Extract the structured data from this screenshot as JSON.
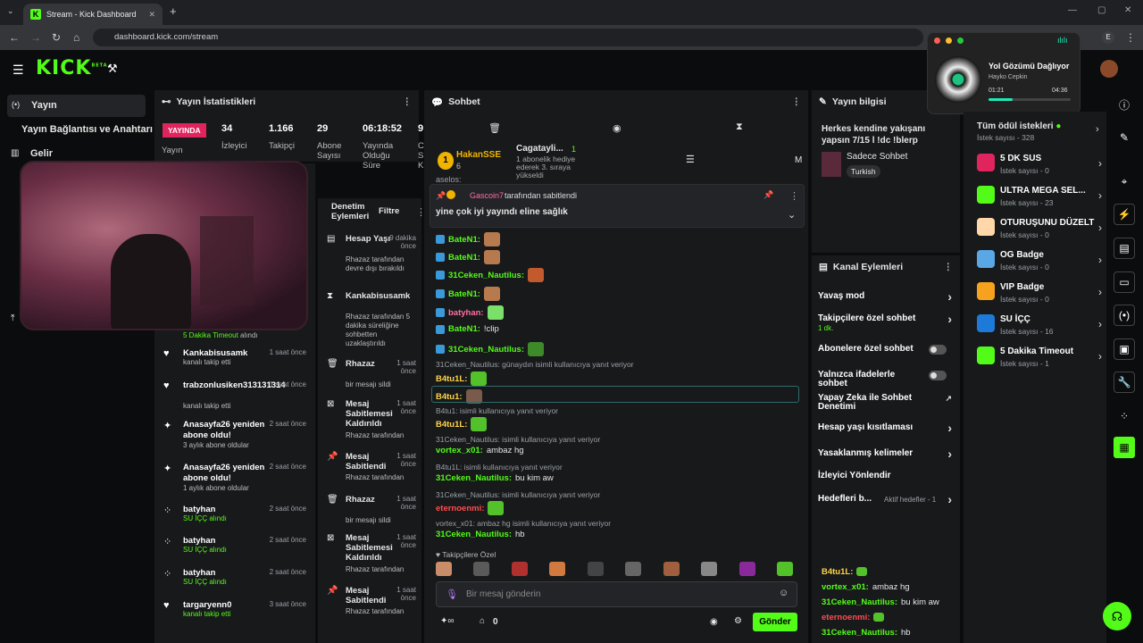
{
  "browser": {
    "tab_title": "Stream - Kick Dashboard",
    "url": "dashboard.kick.com/stream",
    "profile": "E"
  },
  "logo": {
    "text": "KICK",
    "beta": "BETA"
  },
  "nav": {
    "items": [
      {
        "label": "Yayın",
        "icon": "broadcast-icon"
      },
      {
        "label": "Yayın Bağlantısı ve Anahtarı"
      },
      {
        "label": "Gelir",
        "icon": "chart-icon"
      }
    ]
  },
  "stats": {
    "title": "Yayın İstatistikleri",
    "live": "YAYINDA",
    "live_label": "Yayın",
    "items": [
      {
        "value": "34",
        "label": "İzleyici"
      },
      {
        "value": "1.166",
        "label": "Takipçi"
      },
      {
        "value": "29",
        "label": "Abone Sayısı"
      },
      {
        "value": "06:18:52",
        "label": "Yayında Olduğu Süre"
      },
      {
        "value": "9",
        "label": "C S K"
      }
    ]
  },
  "mod": {
    "title": "Denetim Eylemleri",
    "filter": "Filtre",
    "items": [
      {
        "icon": "mute-icon",
        "name": "Hesap Yaşı",
        "time": "9 dakika önce",
        "desc": "Rhazaz tarafından devre dışı bırakıldı",
        "emph": "Rhazaz"
      },
      {
        "icon": "hourglass-icon",
        "name": "Kankabisusamk",
        "time": "",
        "desc": "Rhazaz tarafından 5 dakika süreliğine sohbetten uzaklaştırıldı",
        "emph": "Rhazaz"
      },
      {
        "icon": "trash-icon",
        "name": "Rhazaz",
        "time": "1 saat önce",
        "desc": "bir mesajı sildi",
        "emph": ""
      },
      {
        "icon": "unpin-icon",
        "name": "Mesaj Sabitlemesi Kaldırıldı",
        "time": "1 saat önce",
        "desc": "Rhazaz tarafından",
        "emph": "Rhazaz"
      },
      {
        "icon": "pin-icon",
        "name": "Mesaj Sabitlendi",
        "time": "1 saat önce",
        "desc": "Rhazaz tarafından",
        "emph": "Rhazaz"
      },
      {
        "icon": "trash-icon",
        "name": "Rhazaz",
        "time": "1 saat önce",
        "desc": "bir mesajı sildi",
        "emph": ""
      },
      {
        "icon": "unpin-icon",
        "name": "Mesaj Sabitlemesi Kaldırıldı",
        "time": "1 saat önce",
        "desc": "Rhazaz tarafından",
        "emph": "Rhazaz"
      },
      {
        "icon": "pin-icon",
        "name": "Mesaj Sabitlendi",
        "time": "1 saat önce",
        "desc": "Rhazaz tarafından",
        "emph": "Rhazaz"
      }
    ]
  },
  "activity": {
    "timeout_note": "5 Dakika Timeout",
    "timeout_suffix": "alındı",
    "items": [
      {
        "icon": "heart-icon",
        "name": "Kankabisusamk",
        "time": "1 saat önce",
        "desc": "kanalı takip etti"
      },
      {
        "icon": "heart-icon",
        "name": "trabzonlusiken313131314",
        "time": "1 saat önce",
        "desc": "kanalı takip etti"
      },
      {
        "icon": "sparkle-icon",
        "name": "Anasayfa26 yeniden abone oldu!",
        "time": "2 saat önce",
        "desc": "3 aylık abone oldular"
      },
      {
        "icon": "sparkle-icon",
        "name": "Anasayfa26 yeniden abone oldu!",
        "time": "2 saat önce",
        "desc": "1 aylık abone oldular"
      },
      {
        "icon": "reward-icon",
        "name": "batyhan",
        "time": "2 saat önce",
        "desc": "SU İÇÇ alındı"
      },
      {
        "icon": "reward-icon",
        "name": "batyhan",
        "time": "2 saat önce",
        "desc": "SU İÇÇ alındı"
      },
      {
        "icon": "reward-icon",
        "name": "batyhan",
        "time": "2 saat önce",
        "desc": "SU İÇÇ alındı"
      },
      {
        "icon": "heart-icon",
        "name": "targaryenn0",
        "time": "3 saat önce",
        "desc": "kanalı takip etti"
      }
    ]
  },
  "chat": {
    "title": "Sohbet",
    "top_user": "HakanSSE",
    "top_count": "6",
    "gift_user": "Cagatayli...",
    "gift_text": "1 abonelik hediye ederek 3. sıraya yükseldi",
    "gift_num": "1",
    "cut_user": "aselos:",
    "pinned_by": "Gascoin7",
    "pinned_suffix": "tarafından sabitlendi",
    "pinned_msg": "yine çok iyi yayındı eline sağlık",
    "messages": [
      {
        "user": "BateN1:",
        "color": "#53fc18",
        "text": ""
      },
      {
        "user": "BateN1:",
        "color": "#53fc18",
        "text": ""
      },
      {
        "user": "31Ceken_Nautilus:",
        "color": "#53fc18",
        "text": ""
      },
      {
        "user": "BateN1:",
        "color": "#53fc18",
        "text": ""
      },
      {
        "user": "batyhan:",
        "color": "#ff6fa1",
        "text": ""
      },
      {
        "user": "BateN1:",
        "color": "#53fc18",
        "text": "!clip"
      },
      {
        "user": "31Ceken_Nautilus:",
        "color": "#53fc18",
        "text": ""
      }
    ],
    "replies": [
      {
        "reply": "31Ceken_Nautilus: günaydın isimli kullanıcıya yanıt veriyor",
        "user": "B4tu1L:",
        "color": "#ffd54a",
        "text": ""
      },
      {
        "reply": "",
        "user": "B4tu1:",
        "color": "#ffd54a",
        "text": ""
      },
      {
        "reply": "B4tu1: isimli kullanıcıya yanıt veriyor",
        "user": "B4tu1L:",
        "color": "#ffd54a",
        "text": ""
      },
      {
        "reply": "31Ceken_Nautilus: isimli kullanıcıya yanıt veriyor",
        "user": "vortex_x01:",
        "color": "#53fc18",
        "text": "ambaz hg"
      },
      {
        "reply": "B4tu1L: isimli kullanıcıya yanıt veriyor",
        "user": "31Ceken_Nautilus:",
        "color": "#53fc18",
        "text": "bu kim aw"
      },
      {
        "reply": "31Ceken_Nautilus: isimli kullanıcıya yanıt veriyor",
        "user": "eternoenmi:",
        "color": "#ff4d4d",
        "text": ""
      },
      {
        "reply": "vortex_x01: ambaz hg isimli kullanıcıya yanıt veriyor",
        "user": "31Ceken_Nautilus:",
        "color": "#53fc18",
        "text": "hb"
      }
    ],
    "followers_only": "Takipçilere Özel",
    "placeholder": "Bir mesaj gönderin",
    "points": "0",
    "send": "Gönder"
  },
  "info": {
    "title": "Yayın bilgisi",
    "stream_title": "Herkes kendine yakışanı yapsın 7/15 l !dc !blerp",
    "mode": "Sadece Sohbet",
    "tag": "Turkish"
  },
  "actions": {
    "title": "Kanal Eylemleri",
    "items": [
      {
        "label": "Yavaş mod",
        "kind": "chev",
        "sub": ""
      },
      {
        "label": "Takipçilere özel sohbet",
        "kind": "chev",
        "sub": "1 dk."
      },
      {
        "label": "Abonelere özel sohbet",
        "kind": "toggle",
        "sub": ""
      },
      {
        "label": "Yalnızca ifadelerle sohbet",
        "kind": "toggle",
        "sub": ""
      },
      {
        "label": "Yapay Zeka ile Sohbet Denetimi",
        "kind": "ext",
        "sub": ""
      },
      {
        "label": "Hesap yaşı kısıtlaması",
        "kind": "chev",
        "sub": ""
      },
      {
        "label": "Yasaklanmış kelimeler",
        "kind": "chev",
        "sub": ""
      },
      {
        "label": "İzleyici Yönlendir",
        "kind": "none",
        "sub": ""
      },
      {
        "label": "Hedefleri b...",
        "kind": "chev",
        "sub": "Aktif hedefler - 1"
      }
    ]
  },
  "minichat": [
    {
      "user": "B4tu1L:",
      "text": ""
    },
    {
      "user": "vortex_x01:",
      "text": "ambaz hg"
    },
    {
      "user": "31Ceken_Nautilus:",
      "text": "bu kim aw"
    },
    {
      "user": "eternoenmi:",
      "text": ""
    },
    {
      "user": "31Ceken_Nautilus:",
      "text": "hb"
    }
  ],
  "rewards": {
    "all": "Tüm ödül istekleri",
    "all_count": "İstek sayısı - 328",
    "items": [
      {
        "name": "5 DK SUS",
        "count": "İstek sayısı - 0",
        "color": "#e0245e"
      },
      {
        "name": "ULTRA MEGA SEL...",
        "count": "İstek sayısı - 23",
        "color": "#53fc18"
      },
      {
        "name": "OTURUŞUNU DÜZELT",
        "count": "İstek sayısı - 0",
        "color": "#ffd7a8"
      },
      {
        "name": "OG Badge",
        "count": "İstek sayısı - 0",
        "color": "#5aa7e6"
      },
      {
        "name": "VIP Badge",
        "count": "İstek sayısı - 0",
        "color": "#f6a21e"
      },
      {
        "name": "SU İÇÇ",
        "count": "İstek sayısı - 16",
        "color": "#1e7ad9"
      },
      {
        "name": "5 Dakika Timeout",
        "count": "İstek sayısı - 1",
        "color": "#53fc18"
      }
    ]
  },
  "music": {
    "title": "Yol Gözümü Dağlıyor",
    "artist": "Hayko Cepkin",
    "elapsed": "01:21",
    "total": "04:36",
    "progress": 0.29
  }
}
